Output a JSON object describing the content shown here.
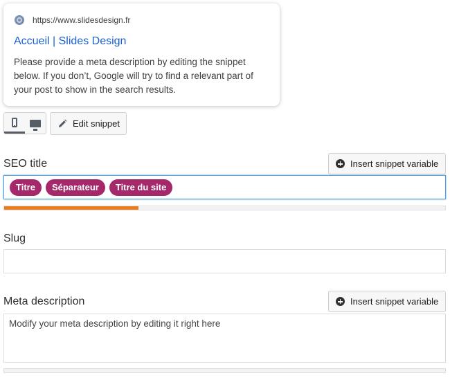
{
  "snippet_preview": {
    "url": "https://www.slidesdesign.fr",
    "title": "Accueil | Slides Design",
    "description": "Please provide a meta description by editing the snippet below. If you don’t, Google will try to find a relevant part of your post to show in the search results."
  },
  "preview_mode": {
    "modes": [
      "mobile",
      "desktop"
    ],
    "active": "mobile"
  },
  "edit_snippet": {
    "label": "Edit snippet"
  },
  "seo_title": {
    "label": "SEO title",
    "insert_button": "Insert snippet variable",
    "variables": [
      "Titre",
      "Séparateur",
      "Titre du site"
    ],
    "progress_percent": 30.5,
    "progress_color": "#ee7c1b"
  },
  "slug": {
    "label": "Slug",
    "value": ""
  },
  "meta_description": {
    "label": "Meta description",
    "insert_button": "Insert snippet variable",
    "placeholder": "Modify your meta description by editing it right here",
    "progress_percent": 0
  },
  "colors": {
    "variable_pill": "#a4286a",
    "link_title": "#1b5fd0",
    "focus_border": "#5b9dd9"
  }
}
